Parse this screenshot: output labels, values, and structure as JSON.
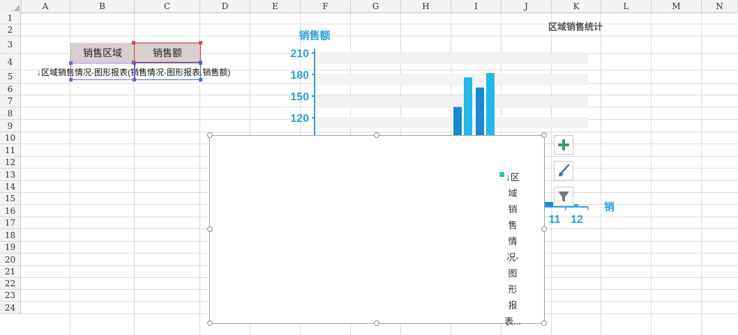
{
  "columns": [
    "A",
    "B",
    "C",
    "D",
    "E",
    "F",
    "G",
    "H",
    "I",
    "J",
    "K",
    "L",
    "M",
    "N"
  ],
  "rows": [
    "1",
    "2",
    "3",
    "4",
    "5",
    "6",
    "7",
    "8",
    "9",
    "10",
    "11",
    "12",
    "13",
    "14",
    "15",
    "16",
    "17",
    "18",
    "19",
    "20",
    "21",
    "22",
    "23",
    "24"
  ],
  "cells": {
    "B3": "销售区域",
    "C3": "销售额",
    "A4": "↓区域销售情况-图形报表(销售情况-图形报表.销售额)"
  },
  "chart_data": {
    "type": "bar",
    "title": "区域销售统计",
    "ylabel": "销售额",
    "xlabel": "销",
    "y_ticks": [
      "120",
      "150",
      "180",
      "210"
    ],
    "x_ticks": [
      "11",
      "12"
    ],
    "ylim": [
      0,
      210
    ],
    "series": [
      {
        "name": "↓区域销售情况-图形报表...",
        "values": [
          135,
          176,
          162,
          182
        ]
      }
    ],
    "legend_position": "right",
    "colors": {
      "axis": "#2fa0d8",
      "bar_dark": "#1a8ad0",
      "bar_light": "#22b8e8",
      "legend": "#2ec4c4"
    }
  },
  "legend_chars": [
    "↓区",
    "域",
    "销",
    "售",
    "情",
    "况-",
    "图",
    "形",
    "报",
    "表..."
  ],
  "toolbar": {
    "add_icon": "plus-icon",
    "style_icon": "brush-icon",
    "filter_icon": "filter-icon"
  }
}
